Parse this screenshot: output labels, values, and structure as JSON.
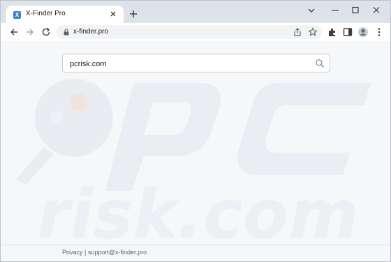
{
  "tab": {
    "favicon": "X",
    "title": "X-Finder Pro",
    "close_icon": "close-icon",
    "new_tab_icon": "plus-icon"
  },
  "window_controls": [
    "chevron-down-icon",
    "minimize-icon",
    "maximize-icon",
    "close-icon"
  ],
  "toolbar": {
    "url": "x-finder.pro",
    "icons": [
      "back-arrow-icon",
      "forward-arrow-icon",
      "reload-icon",
      "lock-icon",
      "share-icon",
      "star-icon",
      "extensions-icon",
      "side-panel-icon",
      "profile-icon",
      "kebab-menu-icon"
    ]
  },
  "search": {
    "value": "pcrisk.com",
    "icon": "search-icon"
  },
  "footer": {
    "privacy": "Privacy",
    "separator": "|",
    "email": "support@x-finder.pro"
  },
  "watermark": {
    "text": "risk.com"
  },
  "colors": {
    "tab_bar": "#dee3ea",
    "page_bg": "#f5f7f9",
    "favicon": "#3b7fd6"
  }
}
